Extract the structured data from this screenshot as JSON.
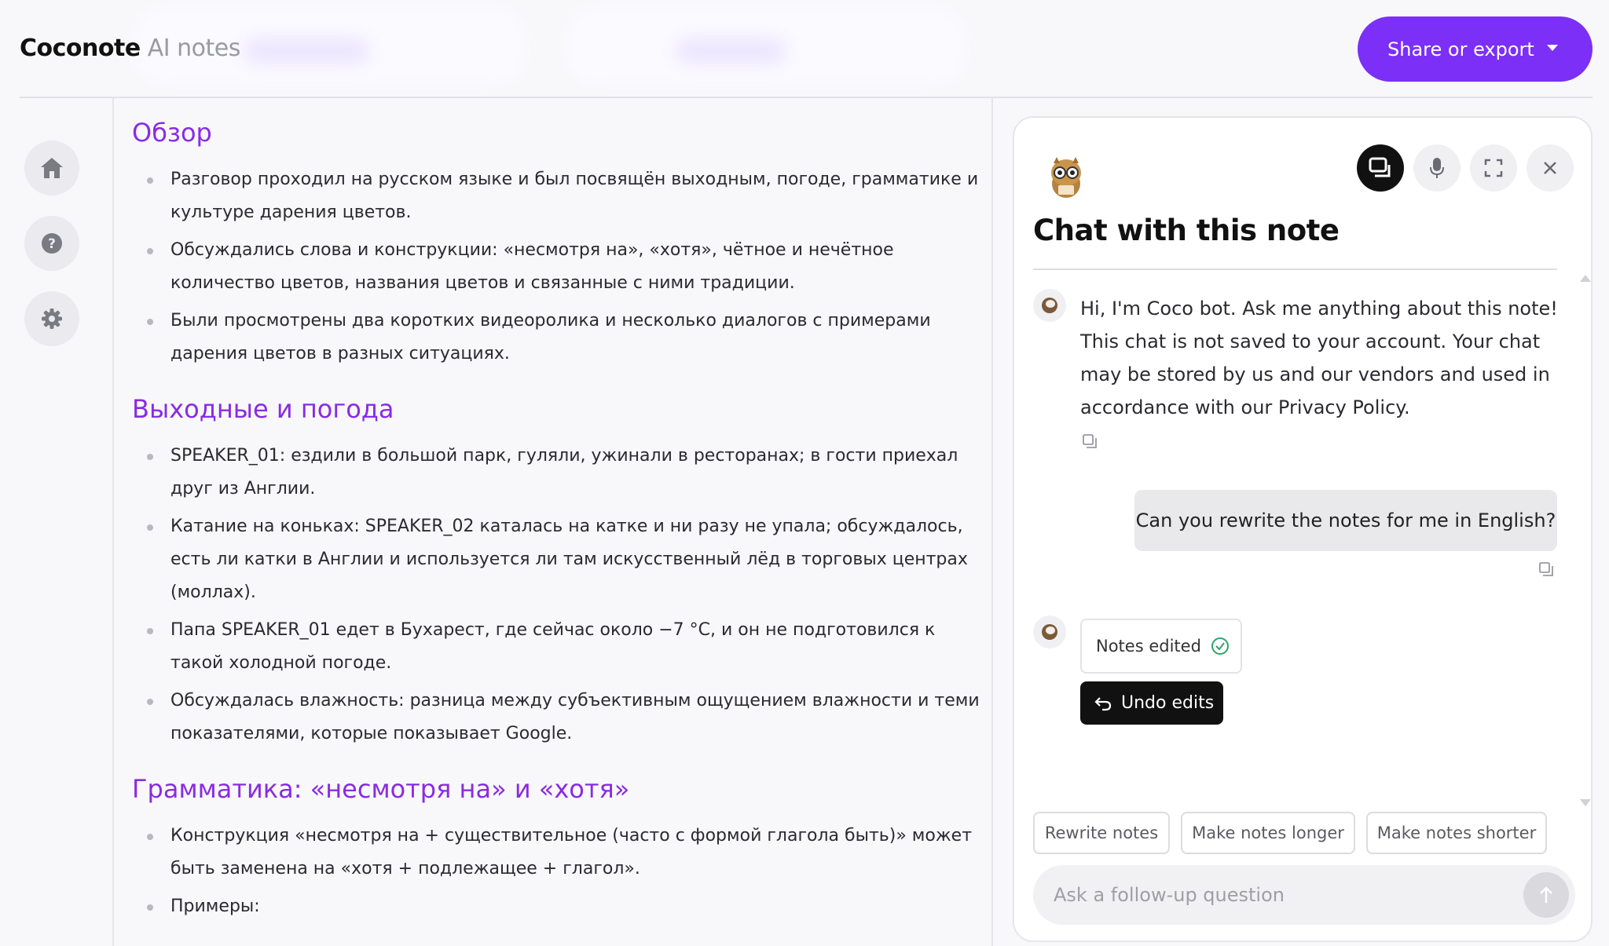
{
  "header": {
    "brand": "Coconote",
    "brand_sub": "AI notes",
    "share_button": "Share or export"
  },
  "colors": {
    "accent": "#7b2ff7",
    "section_heading": "#8a2be2"
  },
  "sidebar": {
    "items": [
      {
        "icon": "home-icon"
      },
      {
        "icon": "help-icon"
      },
      {
        "icon": "gear-icon"
      }
    ]
  },
  "notes": {
    "sections": [
      {
        "title": "Обзор",
        "bullets": [
          "Разговор проходил на русском языке и был посвящён выходным, погоде, грамматике и культуре дарения цветов.",
          "Обсуждались слова и конструкции: «несмотря на», «хотя», чётное и нечётное количество цветов, названия цветов и связанные с ними традиции.",
          "Были просмотрены два коротких видеоролика и несколько диалогов с примерами дарения цветов в разных ситуациях."
        ]
      },
      {
        "title": "Выходные и погода",
        "bullets": [
          "SPEAKER_01: ездили в большой парк, гуляли, ужинали в ресторанах; в гости приехал друг из Англии.",
          "Катание на коньках: SPEAKER_02 каталась на катке и ни разу не упала; обсуждалось, есть ли катки в Англии и используется ли там искусственный лёд в торговых центрах (моллах).",
          "Папа SPEAKER_01 едет в Бухарест, где сейчас около −7 °C, и он не подготовился к такой холодной погоде.",
          "Обсуждалась влажность: разница между субъективным ощущением влажности и теми показателями, которые показывает Google."
        ]
      },
      {
        "title": "Грамматика: «несмотря на» и «хотя»",
        "bullets": [
          "Конструкция «несмотря на + существительное (часто с формой глагола быть)» может быть заменена на «хотя + подлежащее + глагол».",
          "Примеры:"
        ]
      }
    ]
  },
  "chat": {
    "title": "Chat with this note",
    "bot_message": "Hi, I'm Coco bot. Ask me anything about this note! This chat is not saved to your account. Your chat may be stored by us and our vendors and used in accordance with our Privacy Policy.",
    "user_message": "Can you rewrite the notes for me in English?",
    "notes_edited": "Notes edited",
    "undo_label": "Undo edits",
    "suggestions": [
      "Rewrite notes",
      "Make notes longer",
      "Make notes shorter"
    ],
    "input_placeholder": "Ask a follow-up question"
  }
}
